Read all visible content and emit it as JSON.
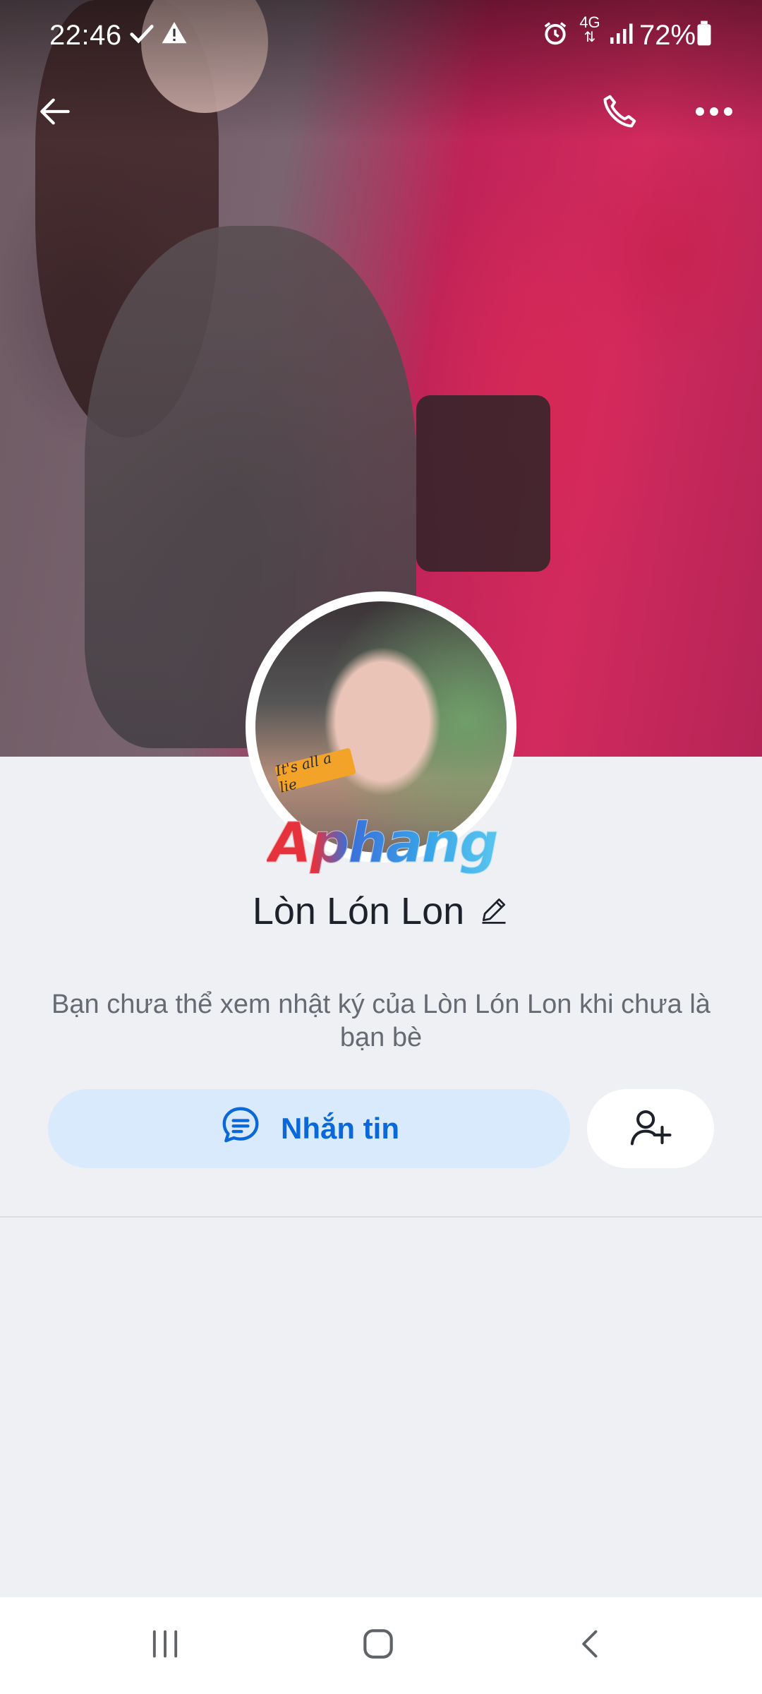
{
  "status_bar": {
    "time": "22:46",
    "network": "4G",
    "battery": "72%"
  },
  "header": {
    "back_icon": "arrow-left-icon",
    "call_icon": "phone-icon",
    "more_icon": "more-horizontal-icon"
  },
  "profile": {
    "name": "Lòn Lón Lon",
    "avatar_sticker": "It's all a lie",
    "watermark": "Aphang",
    "notice": "Bạn chưa thể xem nhật ký của Lòn Lón Lon khi chưa là bạn bè"
  },
  "actions": {
    "message_label": "Nhắn tin",
    "message_icon": "chat-bubble-icon",
    "add_friend_icon": "add-person-icon"
  },
  "colors": {
    "accent": "#0a68d9",
    "message_button_bg": "#d9eafd",
    "page_bg": "#eff0f4"
  },
  "nav_bar": {
    "recent_icon": "recent-apps-icon",
    "home_icon": "home-icon",
    "back_icon": "back-chevron-icon"
  }
}
